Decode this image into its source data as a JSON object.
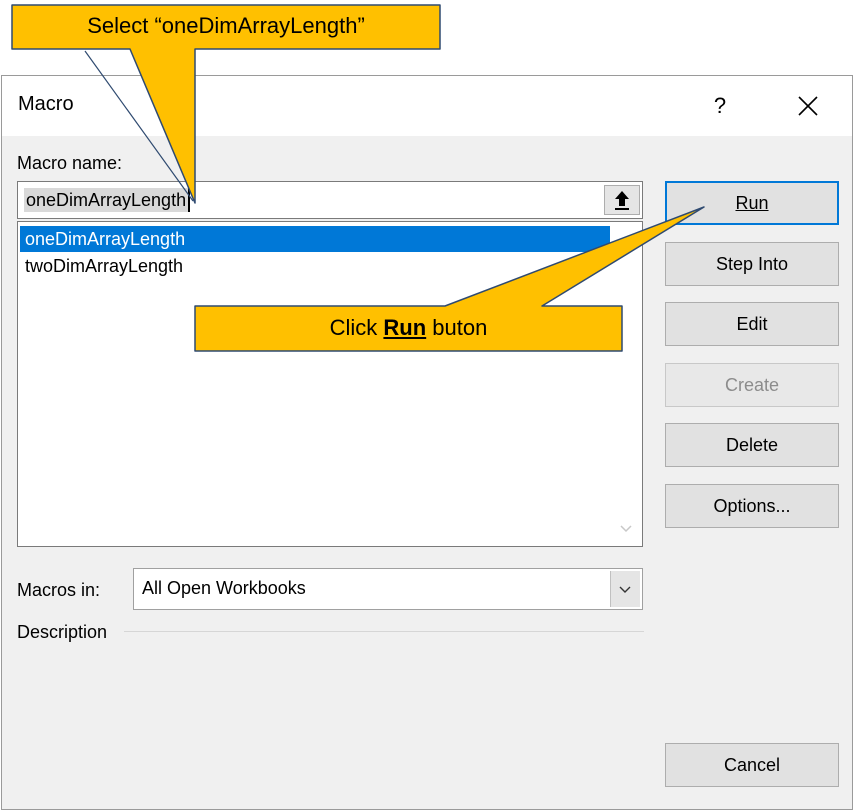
{
  "dialog": {
    "title": "Macro",
    "help_label": "?",
    "macro_name_label": "Macro name:",
    "macro_name_value": "oneDimArrayLength",
    "macro_list": [
      {
        "label": "oneDimArrayLength",
        "selected": true
      },
      {
        "label": "twoDimArrayLength",
        "selected": false
      }
    ],
    "macros_in_label": "Macros in:",
    "macros_in_value": "All Open Workbooks",
    "description_label": "Description",
    "buttons": {
      "run": "Run",
      "step_into": "Step Into",
      "edit": "Edit",
      "create": "Create",
      "delete": "Delete",
      "options": "Options...",
      "cancel": "Cancel"
    }
  },
  "callouts": {
    "select_text": "Select “oneDimArrayLength”",
    "click_prefix": "Click ",
    "click_bold": "Run",
    "click_suffix": " buton"
  },
  "colors": {
    "callout_fill": "#ffc000",
    "selection": "#0078d7",
    "dialog_bg": "#f0f0f0"
  }
}
